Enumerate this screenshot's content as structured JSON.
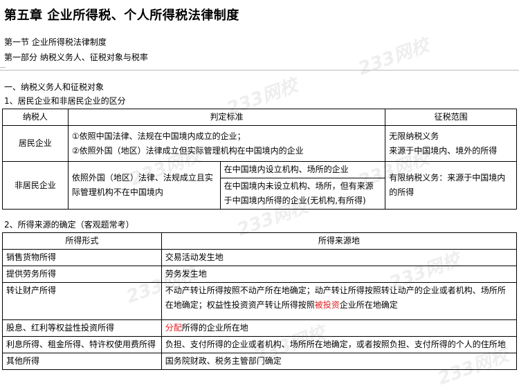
{
  "title": "第五章  企业所得税、个人所得税法律制度",
  "section": "第一节  企业所得税法律制度",
  "part": "第一部分    纳税义务人、征税对象与税率",
  "heading1": "一、纳税义务人和征税对象",
  "heading2": "1、居民企业和非居民企业的区分",
  "table1": {
    "headers": [
      "纳税人",
      "判定标准",
      "征税范围"
    ],
    "resident": {
      "name": "居民企业",
      "criterion1": "①依照中国法律、法规在中国境内成立的企业；",
      "criterion2": "②依照外国（地区）法律成立但实际管理机构在中国境内的企业",
      "scope_line1": "无限纳税义务",
      "scope_line2": "来源于中国境内、境外的所得"
    },
    "nonresident": {
      "name": "非居民企业",
      "criterion": "依照外国（地区）法律、法规成立且实际管理机构不在中国境内",
      "sub1": "在中国境内设立机构、场所的企业",
      "sub2": "在中国境内未设立机构、场所，但有来源于中国境内所得的企业(无机构,有所得)",
      "scope": "有限纳税义务：来源于中国境内的所得"
    }
  },
  "heading3": "2、所得来源的确定（客观题常考）",
  "table2": {
    "headers": [
      "所得形式",
      "所得来源地"
    ],
    "rows": [
      {
        "form": "销售货物所得",
        "source": "交易活动发生地"
      },
      {
        "form": "提供劳务所得",
        "source": "劳务发生地"
      },
      {
        "form": "转让财产所得",
        "source_a": "不动产转让所得按照不动产所在地确定；动产转让所得按照转让动产的企业或者机构、场所所在地确定；权益性投资资产转让所得按照",
        "source_red": "被投资",
        "source_b": "企业所在地确定"
      },
      {
        "form": "股息、红利等权益性投资所得",
        "source_red": "分配",
        "source_b": "所得的企业所在地"
      },
      {
        "form": "利息所得、租金所得、特许权使用费所得",
        "source": "负担、支付所得的企业或者机构、场所所在地确定，或者按照负担、支付所得的个人的住所地"
      },
      {
        "form": "其他所得",
        "source": "国务院财政、税务主管部门确定"
      }
    ]
  },
  "watermark": "233网校"
}
